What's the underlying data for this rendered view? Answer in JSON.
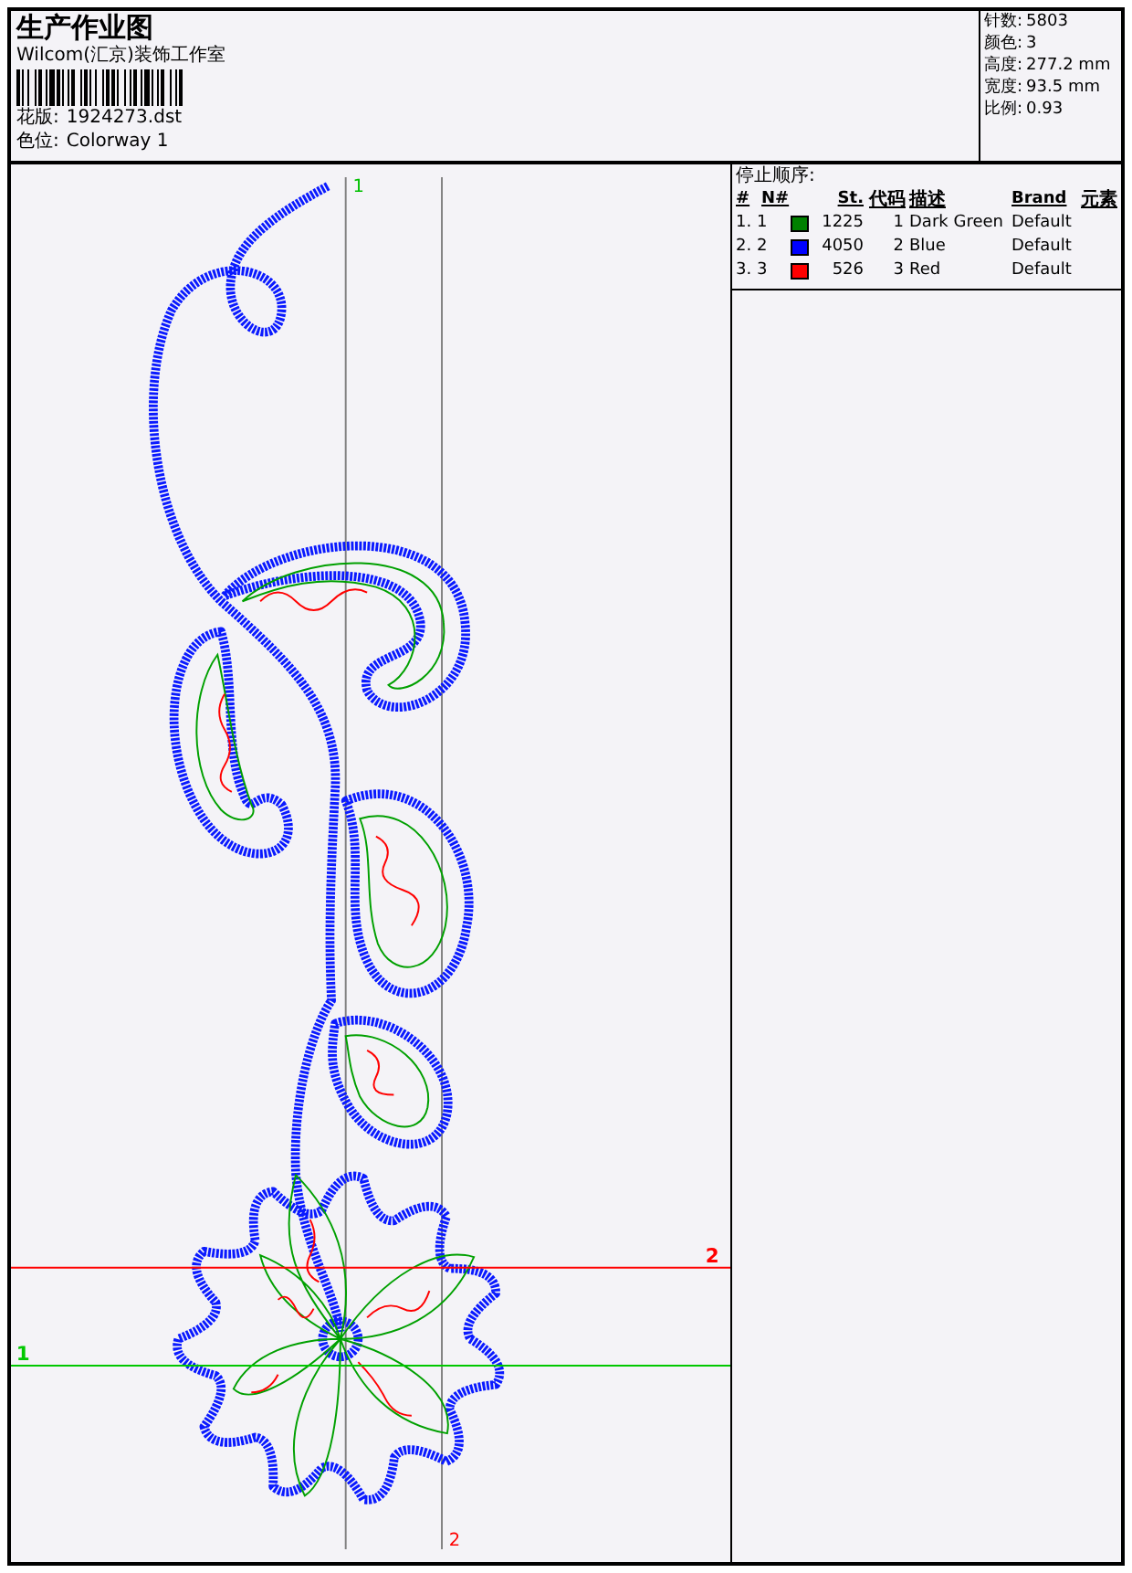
{
  "header": {
    "title": "生产作业图",
    "studio": "Wilcom(汇京)装饰工作室",
    "design_label": "花版:",
    "design_value": "1924273.dst",
    "colorway_label": "色位:",
    "colorway_value": "Colorway 1"
  },
  "stats": [
    {
      "label": "针数:",
      "value": "5803"
    },
    {
      "label": "颜色:",
      "value": "3"
    },
    {
      "label": "高度:",
      "value": "277.2 mm"
    },
    {
      "label": "宽度:",
      "value": "93.5 mm"
    },
    {
      "label": "比例:",
      "value": "0.93"
    }
  ],
  "stop_sequence": {
    "title": "停止顺序:",
    "columns": [
      "#",
      "N#",
      "St.",
      "代码",
      "描述",
      "Brand",
      "元素"
    ],
    "rows": [
      {
        "index": "1. 1",
        "color": "#008000",
        "stitches": "1225",
        "code": "1",
        "description": "Dark Green",
        "brand": "Default"
      },
      {
        "index": "2. 2",
        "color": "#0000ff",
        "stitches": "4050",
        "code": "2",
        "description": "Blue",
        "brand": "Default"
      },
      {
        "index": "3. 3",
        "color": "#ff0000",
        "stitches": "526",
        "code": "3",
        "description": "Red",
        "brand": "Default"
      }
    ]
  },
  "guides": [
    {
      "kind": "vertical",
      "label": "1",
      "color": "#00c000"
    },
    {
      "kind": "horizontal",
      "label": "2",
      "color": "#ff0000"
    },
    {
      "kind": "horizontal",
      "label": "1",
      "color": "#00c800"
    },
    {
      "kind": "vertical",
      "label": "2",
      "color": "#ff0000"
    }
  ]
}
